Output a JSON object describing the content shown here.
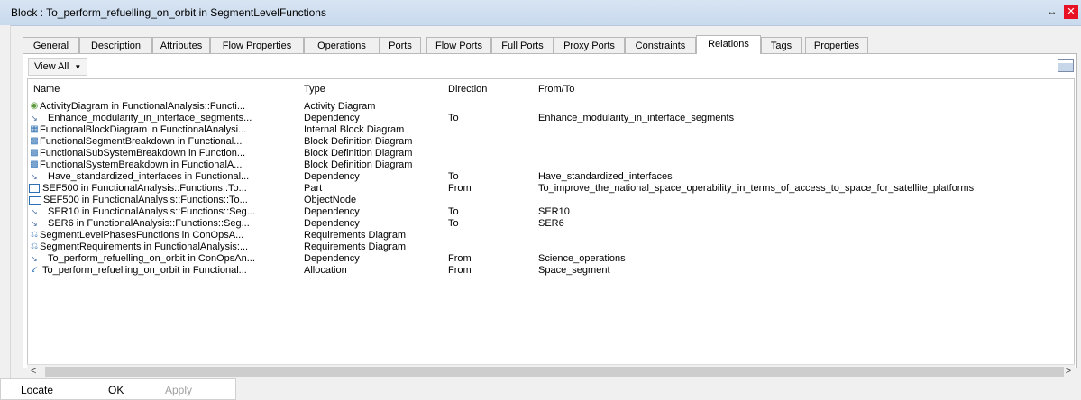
{
  "window": {
    "title": "Block : To_perform_refuelling_on_orbit in SegmentLevelFunctions"
  },
  "tabs": [
    {
      "label": "General"
    },
    {
      "label": "Description"
    },
    {
      "label": "Attributes"
    },
    {
      "label": "Flow Properties"
    },
    {
      "label": "Operations"
    },
    {
      "label": "Ports"
    },
    {
      "label": "Flow Ports"
    },
    {
      "label": "Full Ports"
    },
    {
      "label": "Proxy Ports"
    },
    {
      "label": "Constraints"
    },
    {
      "label": "Relations"
    },
    {
      "label": "Tags"
    },
    {
      "label": "Properties"
    }
  ],
  "active_tab": "Relations",
  "toolbar": {
    "view_all_label": "View All"
  },
  "columns": {
    "name": "Name",
    "type": "Type",
    "direction": "Direction",
    "from_to": "From/To"
  },
  "rows": [
    {
      "icon": "activity-diagram-icon",
      "name": "ActivityDiagram in FunctionalAnalysis::Functi...",
      "type": "Activity Diagram",
      "direction": "",
      "from_to": ""
    },
    {
      "icon": "dependency-icon",
      "name": "Enhance_modularity_in_interface_segments...",
      "type": "Dependency",
      "direction": "To",
      "from_to": "Enhance_modularity_in_interface_segments"
    },
    {
      "icon": "internal-block-diagram-icon",
      "name": "FunctionalBlockDiagram in FunctionalAnalysi...",
      "type": "Internal Block Diagram",
      "direction": "",
      "from_to": ""
    },
    {
      "icon": "block-definition-diagram-icon",
      "name": "FunctionalSegmentBreakdown in Functional...",
      "type": "Block Definition Diagram",
      "direction": "",
      "from_to": ""
    },
    {
      "icon": "block-definition-diagram-icon",
      "name": "FunctionalSubSystemBreakdown in Function...",
      "type": "Block Definition Diagram",
      "direction": "",
      "from_to": ""
    },
    {
      "icon": "block-definition-diagram-icon",
      "name": "FunctionalSystemBreakdown in FunctionalA...",
      "type": "Block Definition Diagram",
      "direction": "",
      "from_to": ""
    },
    {
      "icon": "dependency-icon",
      "name": "Have_standardized_interfaces in Functional...",
      "type": "Dependency",
      "direction": "To",
      "from_to": "Have_standardized_interfaces"
    },
    {
      "icon": "part-icon",
      "name": "SEF500 in FunctionalAnalysis::Functions::To...",
      "type": "Part",
      "direction": "From",
      "from_to": "To_improve_the_national_space_operability_in_terms_of_access_to_space_for_satellite_platforms"
    },
    {
      "icon": "object-node-icon",
      "name": "SEF500 in FunctionalAnalysis::Functions::To...",
      "type": "ObjectNode",
      "direction": "",
      "from_to": ""
    },
    {
      "icon": "dependency-icon",
      "name": "SER10 in FunctionalAnalysis::Functions::Seg...",
      "type": "Dependency",
      "direction": "To",
      "from_to": "SER10"
    },
    {
      "icon": "dependency-icon",
      "name": "SER6 in FunctionalAnalysis::Functions::Seg...",
      "type": "Dependency",
      "direction": "To",
      "from_to": "SER6"
    },
    {
      "icon": "requirements-diagram-icon",
      "name": "SegmentLevelPhasesFunctions in ConOpsA...",
      "type": "Requirements Diagram",
      "direction": "",
      "from_to": ""
    },
    {
      "icon": "requirements-diagram-icon",
      "name": "SegmentRequirements in FunctionalAnalysis:...",
      "type": "Requirements Diagram",
      "direction": "",
      "from_to": ""
    },
    {
      "icon": "dependency-icon",
      "name": "To_perform_refuelling_on_orbit in ConOpsAn...",
      "type": "Dependency",
      "direction": "From",
      "from_to": "Science_operations"
    },
    {
      "icon": "allocation-icon",
      "name": "To_perform_refuelling_on_orbit in Functional...",
      "type": "Allocation",
      "direction": "From",
      "from_to": "Space_segment"
    }
  ],
  "buttons": {
    "locate": "Locate",
    "ok": "OK",
    "apply": "Apply"
  },
  "colors": {
    "titlebar": "#c9daee",
    "close": "#e81123",
    "icon_blue": "#2d6fb3"
  }
}
